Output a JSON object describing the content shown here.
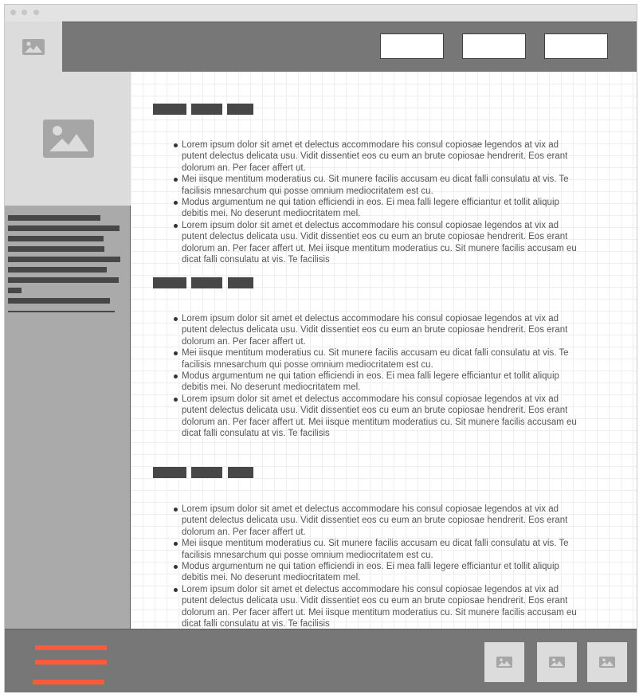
{
  "colors": {
    "window_bg": "#e3e3e3",
    "header_bg": "#777777",
    "sidebar_bg": "#aaaaaa",
    "placeholder_bg": "#dcdcdc",
    "block_dark": "#474747",
    "accent": "#ff5a3c"
  },
  "titlebar": {
    "dots": [
      "window-dot",
      "window-dot",
      "window-dot"
    ]
  },
  "header": {
    "logo_icon": "image-placeholder-icon",
    "nav_buttons": [
      "nav-button-1",
      "nav-button-2",
      "nav-button-3"
    ]
  },
  "sidebar": {
    "image_icon": "image-placeholder-icon",
    "text_lines": 9
  },
  "content": {
    "sections": [
      {
        "bullets": [
          "Lorem ipsum dolor sit amet et delectus accommodare his consul copiosae legendos at vix ad putent delectus delicata usu. Vidit dissentiet eos cu eum an brute copiosae hendrerit. Eos erant dolorum an. Per facer affert ut.",
          "Mei iisque mentitum moderatius cu. Sit munere facilis accusam eu dicat falli consulatu at vis. Te facilisis mnesarchum qui posse omnium mediocritatem est cu.",
          "Modus argumentum ne qui tation efficiendi in eos. Ei mea falli legere efficiantur et tollit aliquip debitis mei. No deserunt mediocritatem mel.",
          "Lorem ipsum dolor sit amet et delectus accommodare his consul copiosae legendos at vix ad putent delectus delicata usu. Vidit dissentiet eos cu eum an brute copiosae hendrerit. Eos erant dolorum an. Per facer affert ut. Mei iisque mentitum moderatius cu. Sit munere facilis accusam eu dicat falli consulatu at vis. Te facilisis"
        ]
      },
      {
        "bullets": [
          "Lorem ipsum dolor sit amet et delectus accommodare his consul copiosae legendos at vix ad putent delectus delicata usu. Vidit dissentiet eos cu eum an brute copiosae hendrerit. Eos erant dolorum an. Per facer affert ut.",
          "Mei iisque mentitum moderatius cu. Sit munere facilis accusam eu dicat falli consulatu at vis. Te facilisis mnesarchum qui posse omnium mediocritatem est cu.",
          "Modus argumentum ne qui tation efficiendi in eos. Ei mea falli legere efficiantur et tollit aliquip debitis mei. No deserunt mediocritatem mel.",
          "Lorem ipsum dolor sit amet et delectus accommodare his consul copiosae legendos at vix ad putent delectus delicata usu. Vidit dissentiet eos cu eum an brute copiosae hendrerit. Eos erant dolorum an. Per facer affert ut. Mei iisque mentitum moderatius cu. Sit munere facilis accusam eu dicat falli consulatu at vis. Te facilisis"
        ]
      },
      {
        "bullets": [
          "Lorem ipsum dolor sit amet et delectus accommodare his consul copiosae legendos at vix ad putent delectus delicata usu. Vidit dissentiet eos cu eum an brute copiosae hendrerit. Eos erant dolorum an. Per facer affert ut.",
          "Mei iisque mentitum moderatius cu. Sit munere facilis accusam eu dicat falli consulatu at vis. Te facilisis mnesarchum qui posse omnium mediocritatem est cu.",
          "Modus argumentum ne qui tation efficiendi in eos. Ei mea falli legere efficiantur et tollit aliquip debitis mei. No deserunt mediocritatem mel.",
          "Lorem ipsum dolor sit amet et delectus accommodare his consul copiosae legendos at vix ad putent delectus delicata usu. Vidit dissentiet eos cu eum an brute copiosae hendrerit. Eos erant dolorum an. Per facer affert ut. Mei iisque mentitum moderatius cu. Sit munere facilis accusam eu dicat falli consulatu at vis. Te facilisis"
        ]
      }
    ]
  },
  "footer": {
    "menu_icon": "hamburger-menu-icon",
    "thumbnails": [
      "image-placeholder-icon",
      "image-placeholder-icon",
      "image-placeholder-icon"
    ]
  }
}
